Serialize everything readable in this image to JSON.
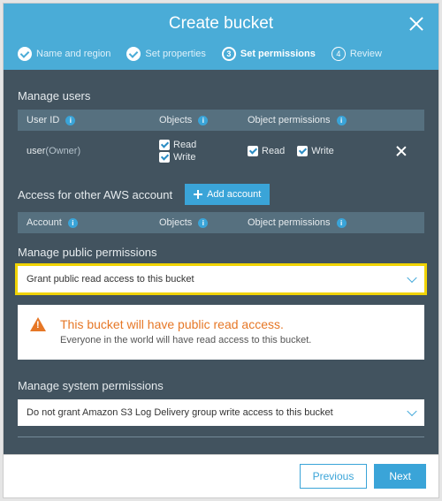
{
  "header": {
    "title": "Create bucket"
  },
  "steps": [
    {
      "label": "Name and region",
      "state": "done"
    },
    {
      "label": "Set properties",
      "state": "done"
    },
    {
      "label": "Set permissions",
      "state": "current",
      "num": "3"
    },
    {
      "label": "Review",
      "state": "todo",
      "num": "4"
    }
  ],
  "manage_users": {
    "title": "Manage users",
    "headers": {
      "user_id": "User ID",
      "objects": "Objects",
      "perms": "Object permissions"
    },
    "row": {
      "user": "user",
      "owner_suffix": "(Owner)",
      "read": "Read",
      "write": "Write"
    }
  },
  "other_account": {
    "title": "Access for other AWS account",
    "button": "Add account",
    "headers": {
      "account": "Account",
      "objects": "Objects",
      "perms": "Object permissions"
    }
  },
  "public_perms": {
    "title": "Manage public permissions",
    "selected": "Grant public read access to this bucket"
  },
  "alert": {
    "title": "This bucket will have public read access.",
    "body": "Everyone in the world will have read access to this bucket."
  },
  "system_perms": {
    "title": "Manage system permissions",
    "selected": "Do not grant Amazon S3 Log Delivery group write access to this bucket"
  },
  "footer": {
    "previous": "Previous",
    "next": "Next"
  }
}
